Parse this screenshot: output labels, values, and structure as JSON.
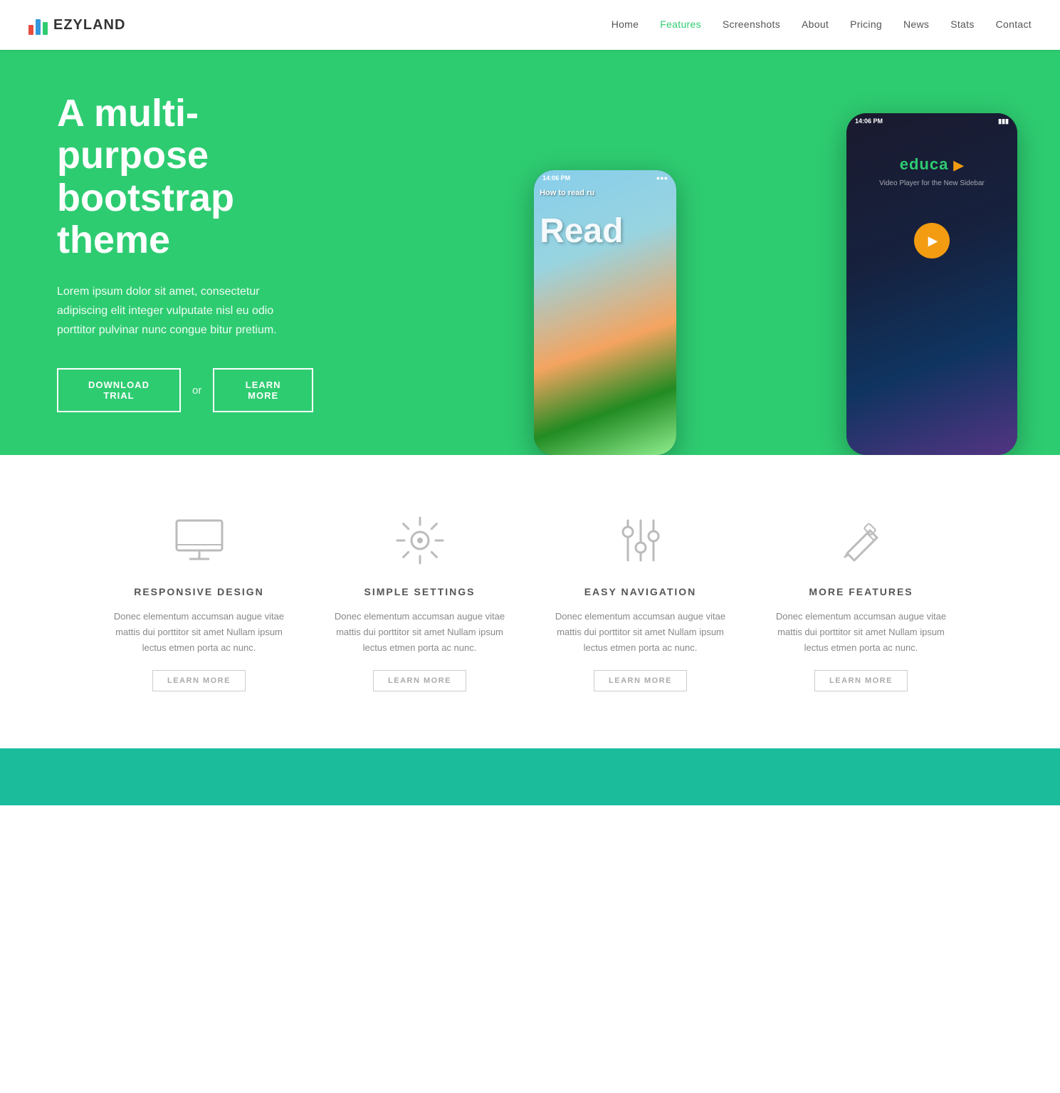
{
  "brand": {
    "name": "EZYLAND",
    "logo_bars": [
      "red",
      "blue",
      "green"
    ]
  },
  "nav": {
    "links": [
      {
        "label": "Home",
        "active": false
      },
      {
        "label": "Features",
        "active": true
      },
      {
        "label": "Screenshots",
        "active": false
      },
      {
        "label": "About",
        "active": false
      },
      {
        "label": "Pricing",
        "active": false
      },
      {
        "label": "News",
        "active": false
      },
      {
        "label": "Stats",
        "active": false
      },
      {
        "label": "Contact",
        "active": false
      }
    ]
  },
  "hero": {
    "title": "A multi-purpose bootstrap theme",
    "description": "Lorem ipsum dolor sit amet, consectetur adipiscing elit integer vulputate nisl eu odio porttitor pulvinar nunc congue bitur pretium.",
    "btn_download": "DOWNLOAD TRIAL",
    "btn_or": "or",
    "btn_learn": "LEARN MORE",
    "phone_left_time": "14:06 PM",
    "phone_right_time": "14:06 PM",
    "app_left_title": "How to read ru",
    "app_left_big": "Read",
    "app_right_name": "educa",
    "app_right_sub": "Video Player for the New Sidebar"
  },
  "features": {
    "items": [
      {
        "icon": "monitor",
        "title": "RESPONSIVE DESIGN",
        "desc": "Donec elementum accumsan augue vitae mattis dui porttitor sit amet Nullam ipsum lectus etmen porta ac nunc.",
        "btn": "LEARN MORE"
      },
      {
        "icon": "settings",
        "title": "SIMPLE SETTINGS",
        "desc": "Donec elementum accumsan augue vitae mattis dui porttitor sit amet Nullam ipsum lectus etmen porta ac nunc.",
        "btn": "LEARN MORE"
      },
      {
        "icon": "sliders",
        "title": "EASY NAVIGATION",
        "desc": "Donec elementum accumsan augue vitae mattis dui porttitor sit amet Nullam ipsum lectus etmen porta ac nunc.",
        "btn": "LEARN MORE"
      },
      {
        "icon": "pencil",
        "title": "MORE FEATURES",
        "desc": "Donec elementum accumsan augue vitae mattis dui porttitor sit amet Nullam ipsum lectus etmen porta ac nunc.",
        "btn": "LEARN MORE"
      }
    ]
  }
}
